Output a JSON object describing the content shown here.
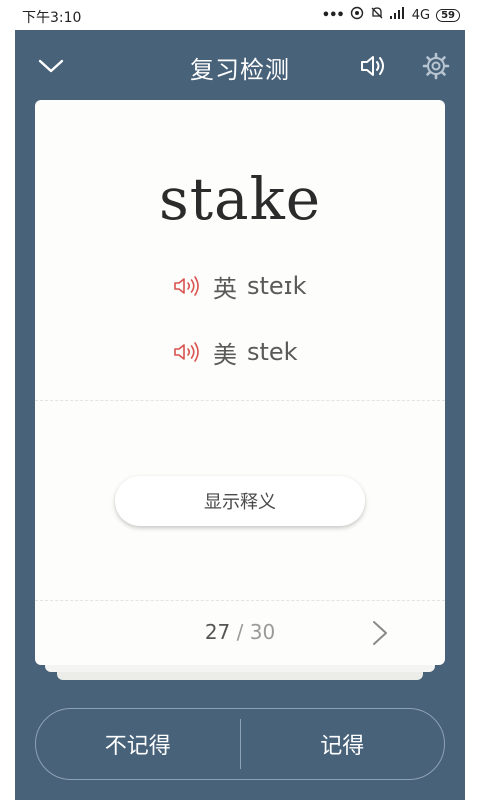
{
  "status_bar": {
    "time": "下午3:10",
    "network": "4G",
    "battery": "59"
  },
  "header": {
    "title": "复习检测"
  },
  "card": {
    "word": "stake",
    "uk": {
      "region": "英",
      "ipa": "steɪk"
    },
    "us": {
      "region": "美",
      "ipa": "stek"
    },
    "show_meaning_label": "显示释义",
    "progress": {
      "current": "27",
      "separator": "/",
      "total": "30"
    }
  },
  "answers": {
    "forgot_label": "不记得",
    "remember_label": "记得"
  },
  "colors": {
    "background": "#48627a",
    "card": "#fdfdfb",
    "speaker_accent": "#d9534f"
  },
  "icons": [
    "chevron-down-icon",
    "speaker-icon",
    "gear-icon",
    "chevron-right-icon"
  ]
}
